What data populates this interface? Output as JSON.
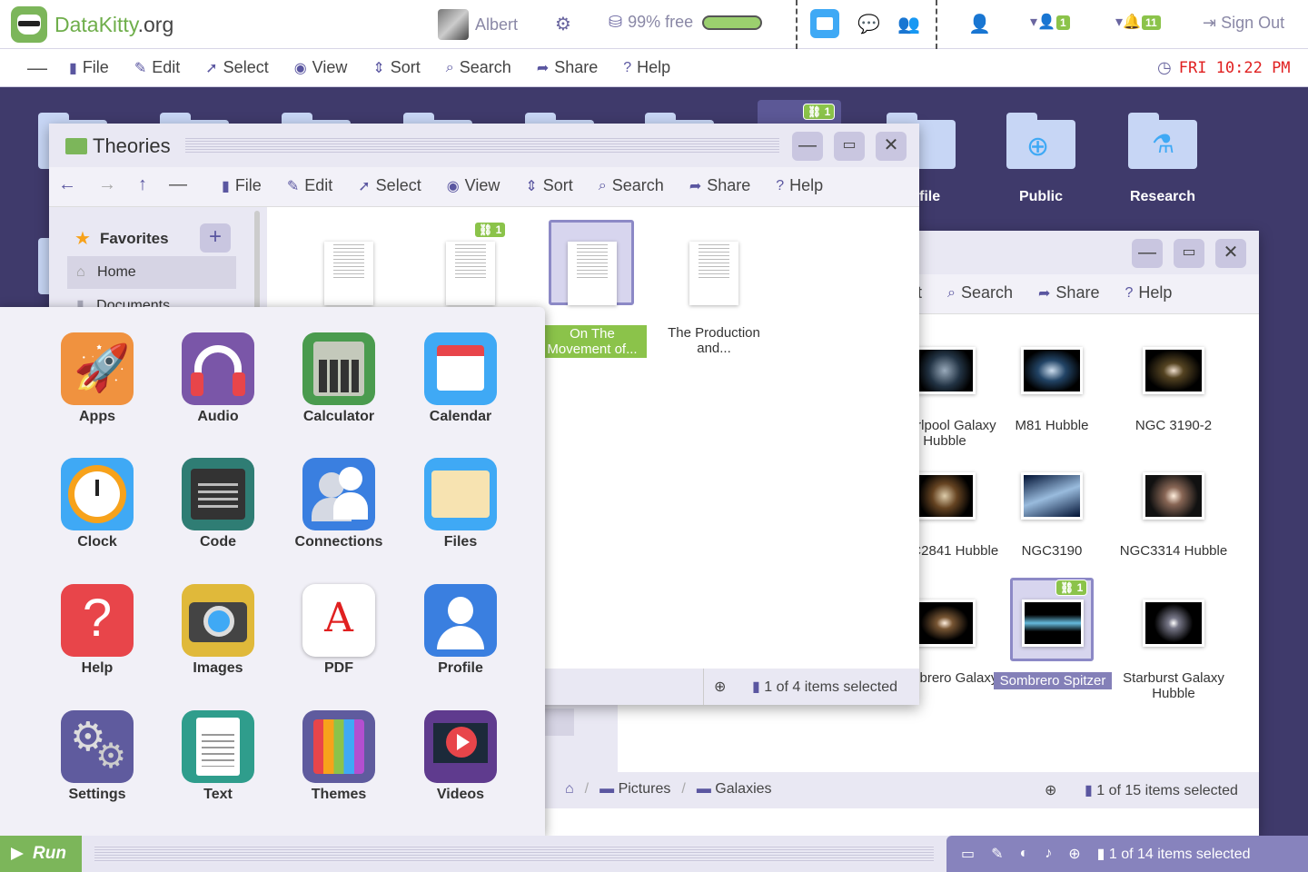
{
  "topbar": {
    "logo_name": "DataKitty",
    "logo_ext": ".org",
    "user_name": "Albert",
    "storage_text": "99% free",
    "storage_percent": 99,
    "badge_users": "1",
    "badge_notices": "11",
    "sign_out": "Sign Out"
  },
  "menubar": {
    "items": [
      "File",
      "Edit",
      "Select",
      "View",
      "Sort",
      "Search",
      "Share",
      "Help"
    ],
    "clock": "FRI 10:22 PM"
  },
  "desktop": {
    "folders": [
      "Public",
      "Research"
    ],
    "partial_label": "file",
    "badge": "1"
  },
  "theories": {
    "title": "Theories",
    "menu": [
      "File",
      "Edit",
      "Select",
      "View",
      "Sort",
      "Search",
      "Share",
      "Help"
    ],
    "sidebar": {
      "favorites": "Favorites",
      "home": "Home",
      "documents": "Documents"
    },
    "files": [
      {
        "name": ""
      },
      {
        "name": "",
        "badge": "1"
      },
      {
        "name": "On The Movement of..."
      },
      {
        "name": "The Production and..."
      }
    ],
    "status": "1 of 4 items selected"
  },
  "galaxies": {
    "menu": [
      "rt",
      "Search",
      "Share",
      "Help"
    ],
    "files": [
      {
        "name": "Whirlpool Galaxy Hubble"
      },
      {
        "name": "M81 Hubble"
      },
      {
        "name": "NGC 3190-2"
      },
      {
        "name": "NGC2841 Hubble"
      },
      {
        "name": "NGC3190"
      },
      {
        "name": "NGC3314 Hubble"
      },
      {
        "name": "Sombrero Galaxy"
      },
      {
        "name": "Sombrero Spitzer",
        "badge": "1"
      },
      {
        "name": "Starburst Galaxy Hubble"
      }
    ],
    "breadcrumb": [
      "Pictures",
      "Galaxies"
    ],
    "status": "1 of 15 items selected"
  },
  "launcher": {
    "apps": [
      "Apps",
      "Audio",
      "Calculator",
      "Calendar",
      "Clock",
      "Code",
      "Connections",
      "Files",
      "Help",
      "Images",
      "PDF",
      "Profile",
      "Settings",
      "Text",
      "Themes",
      "Videos"
    ]
  },
  "taskbar": {
    "run": "Run",
    "status": "1 of 14 items selected"
  }
}
